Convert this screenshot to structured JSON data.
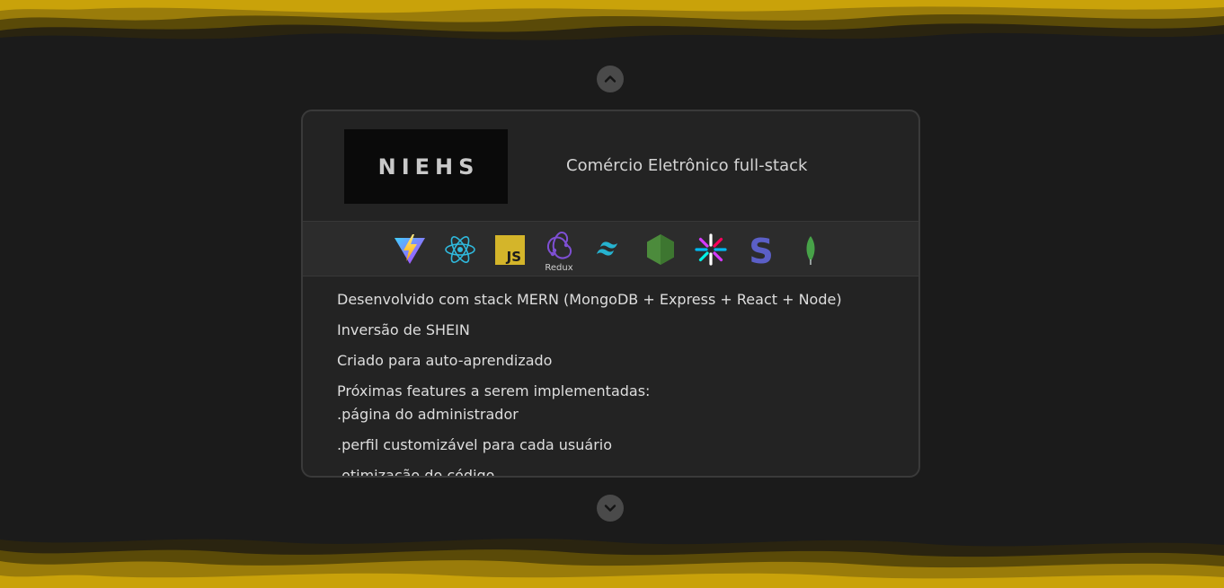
{
  "project": {
    "logo_text": "NIEHS",
    "title": "Comércio Eletrônico full-stack"
  },
  "tech_stack": [
    {
      "name": "Vite",
      "icon": "vite-icon"
    },
    {
      "name": "React",
      "icon": "react-icon"
    },
    {
      "name": "JavaScript",
      "icon": "javascript-icon"
    },
    {
      "name": "Redux",
      "icon": "redux-icon",
      "label": "Redux"
    },
    {
      "name": "Tailwind CSS",
      "icon": "tailwind-icon"
    },
    {
      "name": "Node.js",
      "icon": "nodejs-icon"
    },
    {
      "name": "JWT",
      "icon": "jwt-icon"
    },
    {
      "name": "Stripe",
      "icon": "stripe-icon"
    },
    {
      "name": "MongoDB",
      "icon": "mongodb-icon"
    }
  ],
  "description": [
    "Desenvolvido com stack MERN (MongoDB + Express + React + Node)",
    "Inversão de SHEIN",
    "Criado para auto-aprendizado",
    "Próximas features a serem implementadas:",
    ".página do administrador",
    ".perfil customizável para cada usuário",
    ".otimização do código"
  ],
  "colors": {
    "background": "#1b1b1b",
    "card": "#232323",
    "accent_gold": "#c9a20a"
  },
  "nav": {
    "up_icon": "chevron-up-icon",
    "down_icon": "chevron-down-icon"
  }
}
